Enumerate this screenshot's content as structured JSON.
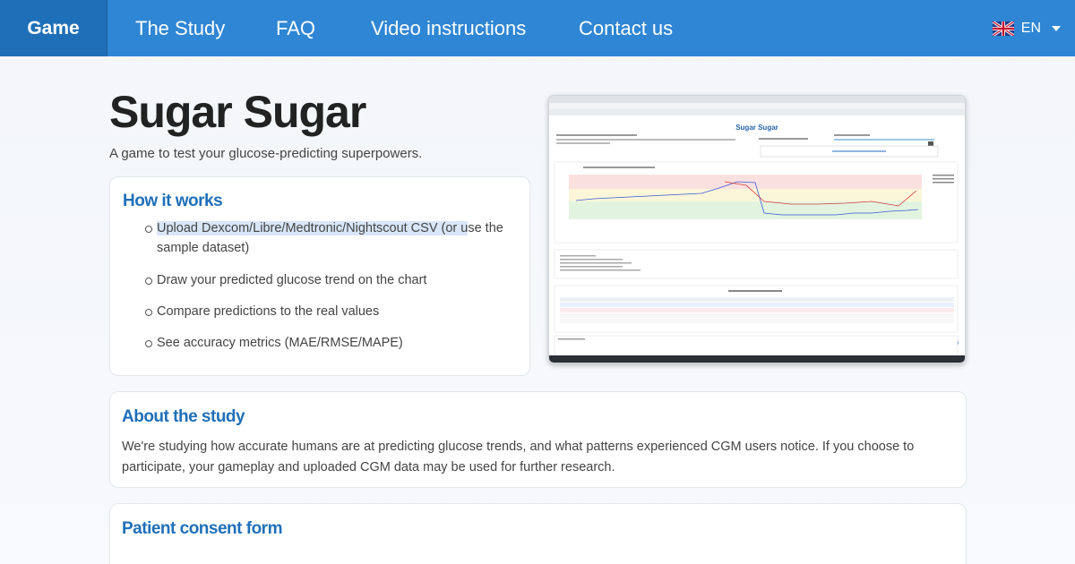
{
  "nav": {
    "brand": "Game",
    "items": [
      "The Study",
      "FAQ",
      "Video instructions",
      "Contact us"
    ],
    "language": "EN"
  },
  "hero": {
    "title": "Sugar Sugar",
    "subtitle": "A game to test your glucose-predicting superpowers."
  },
  "how_it_works": {
    "heading": "How it works",
    "steps": [
      {
        "highlighted": "Upload Dexcom/Libre/Medtronic/Nightscout CSV (or u",
        "rest": "se the sample dataset)"
      },
      {
        "highlighted": "",
        "rest": "Draw your predicted glucose trend on the chart"
      },
      {
        "highlighted": "",
        "rest": "Compare predictions to the real values"
      },
      {
        "highlighted": "",
        "rest": "See accuracy metrics (MAE/RMSE/MAPE)"
      }
    ]
  },
  "screenshot": {
    "title": "Sugar Sugar"
  },
  "about": {
    "heading": "About the study",
    "text": "We're studying how accurate humans are at predicting glucose trends, and what patterns experienced CGM users notice. If you choose to participate, your gameplay and uploaded CGM data may be used for further research."
  },
  "consent": {
    "heading": "Patient consent form"
  },
  "colors": {
    "nav": "#2f86d4",
    "nav_active": "#1f6fb8",
    "heading": "#1f6fb8"
  }
}
